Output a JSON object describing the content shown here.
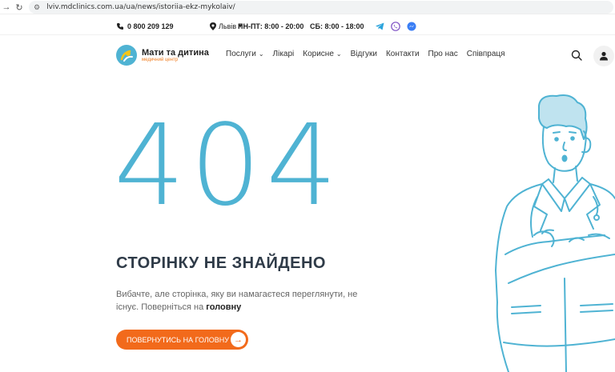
{
  "browser": {
    "url": "lviv.mdclinics.com.ua/ua/news/istoriia-ekz-mykolaiv/"
  },
  "topbar": {
    "phone": "0 800 209 129",
    "city": "Львів",
    "hours_weekday": "ПН-ПТ: 8:00 - 20:00",
    "hours_saturday": "СБ: 8:00 - 18:00",
    "social_icons": [
      "telegram-icon",
      "viber-icon",
      "messenger-icon"
    ]
  },
  "header": {
    "logo_name": "Мати та дитина",
    "logo_sub": "медичний центр",
    "menu": [
      {
        "label": "Послуги",
        "dropdown": true
      },
      {
        "label": "Лікарі",
        "dropdown": false
      },
      {
        "label": "Корисне",
        "dropdown": true
      },
      {
        "label": "Відгуки",
        "dropdown": false
      },
      {
        "label": "Контакти",
        "dropdown": false
      },
      {
        "label": "Про нас",
        "dropdown": false
      },
      {
        "label": "Співпраця",
        "dropdown": false
      }
    ]
  },
  "error": {
    "code": "404",
    "title": "СТОРІНКУ НЕ ЗНАЙДЕНО",
    "desc_text": "Вибачте, але сторінка, яку ви намагаєтеся переглянути, не існує. Поверніться на ",
    "desc_link": "головну",
    "button_label": "ПОВЕРНУТИСЬ НА ГОЛОВНУ"
  },
  "colors": {
    "accent": "#4fb3d3",
    "button": "#f26a1b",
    "title": "#2f3b48"
  }
}
